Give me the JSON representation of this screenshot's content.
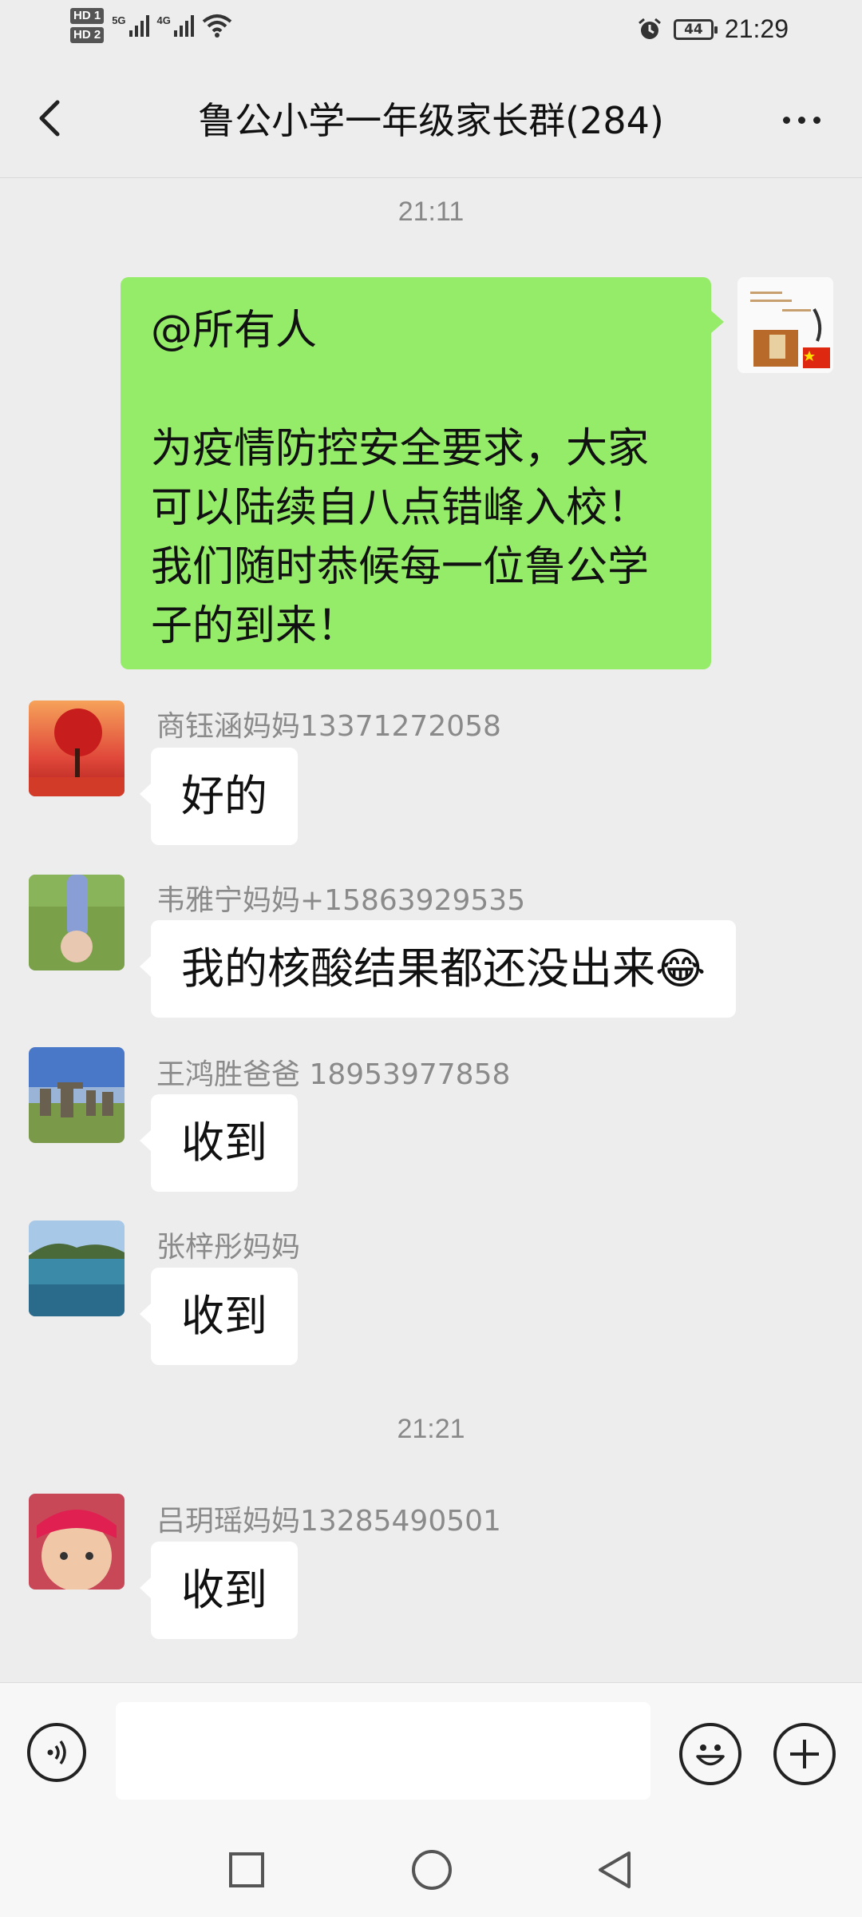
{
  "status_bar": {
    "hd1": "HD 1",
    "hd2": "HD 2",
    "net1": "5G",
    "net2": "4G",
    "battery": "44",
    "time": "21:29"
  },
  "header": {
    "title": "鲁公小学一年级家长群(284)"
  },
  "messages": [
    {
      "type": "time",
      "text": "21:11"
    },
    {
      "type": "mine",
      "text": "@所有人\n\n为疫情防控安全要求，大家可以陆续自八点错峰入校！我们随时恭候每一位鲁公学子的到来！"
    },
    {
      "type": "other",
      "sender": "商钰涵妈妈13371272058",
      "text": "好的"
    },
    {
      "type": "other",
      "sender": "韦雅宁妈妈+15863929535",
      "text": "我的核酸结果都还没出来😂"
    },
    {
      "type": "other",
      "sender": "王鸿胜爸爸 18953977858",
      "text": "收到"
    },
    {
      "type": "other",
      "sender": "张梓彤妈妈",
      "text": "收到"
    },
    {
      "type": "time",
      "text": "21:21"
    },
    {
      "type": "other",
      "sender": "吕玥瑶妈妈13285490501",
      "text": "收到"
    }
  ],
  "input": {
    "value": ""
  },
  "icons": {
    "back": "back-arrow-icon",
    "more": "more-dots-icon",
    "voice": "voice-icon",
    "emoji": "emoji-icon",
    "plus": "plus-icon",
    "nav_recent": "square-icon",
    "nav_home": "circle-icon",
    "nav_back": "triangle-back-icon"
  },
  "colors": {
    "my_bubble": "#95ec69",
    "background": "#ededed"
  }
}
